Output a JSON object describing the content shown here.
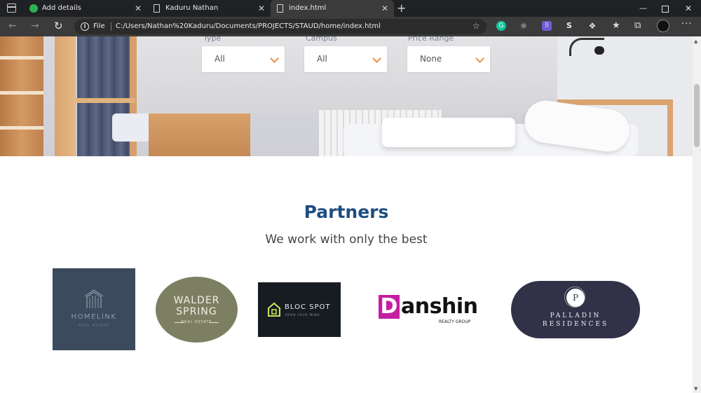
{
  "browser": {
    "tabs": [
      {
        "title": "Add details",
        "favicon": "upwork-icon",
        "active": false
      },
      {
        "title": "Kaduru Nathan",
        "favicon": "page-icon",
        "active": false
      },
      {
        "title": "index.html",
        "favicon": "page-icon",
        "active": true
      }
    ],
    "new_tab": "+",
    "close_glyph": "✕",
    "address": {
      "scheme_label": "File",
      "url": "C:/Users/Nathan%20Kaduru/Documents/PROJECTS/STAUD/home/index.html"
    },
    "extensions": [
      "grammarly-icon",
      "react-devtools-icon",
      "extension-purple-icon",
      "s-extension-icon",
      "extensions-puzzle-icon"
    ],
    "ext_s_label": "S",
    "ext_purple_label": "⠿",
    "window": {
      "minimize": "—",
      "close": "✕"
    },
    "more": "···"
  },
  "search": {
    "filters": [
      {
        "label": "Type",
        "value": "All"
      },
      {
        "label": "Campus",
        "value": "All"
      },
      {
        "label": "Price Range",
        "value": "None"
      }
    ]
  },
  "partners": {
    "title": "Partners",
    "subtitle": "We work with only the best",
    "logos": {
      "homelink": {
        "name": "HOMELINK",
        "tagline": "REAL ESTATE",
        "color": "#3b4a5c"
      },
      "walder": {
        "line1": "WALDER",
        "line2": "SPRING",
        "tagline": "REAL ESTATE",
        "color": "#7d7f63"
      },
      "bloc": {
        "name": "BLOC SPOT",
        "tagline": "OPEN YOUR MIND",
        "color": "#161c22"
      },
      "danshin": {
        "initial": "D",
        "rest": "anshin",
        "tagline": "REALTY GROUP",
        "accent": "#c41ea2"
      },
      "palladin": {
        "initial": "P",
        "line1": "PALLADIN",
        "line2": "RESIDENCES",
        "color": "#313147"
      }
    }
  },
  "colors": {
    "chevron": "#e8914a",
    "partners_title": "#1e4d80"
  }
}
